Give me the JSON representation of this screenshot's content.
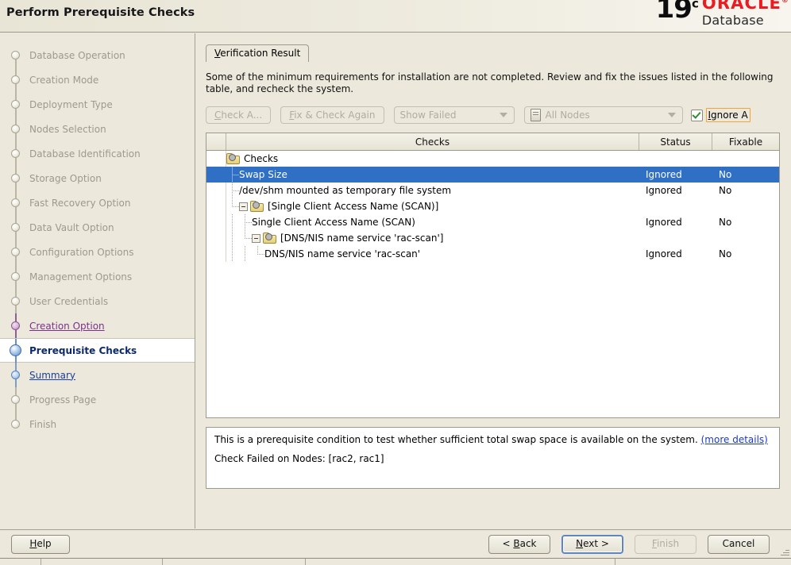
{
  "header": {
    "title": "Perform Prerequisite Checks",
    "brand": {
      "version": "19",
      "version_sup": "c",
      "oracle": "ORACLE",
      "oracle_sup": "®",
      "product": "Database"
    }
  },
  "sidebar": {
    "items": [
      {
        "label": "Database Operation",
        "state": "done"
      },
      {
        "label": "Creation Mode",
        "state": "done"
      },
      {
        "label": "Deployment Type",
        "state": "done"
      },
      {
        "label": "Nodes Selection",
        "state": "done"
      },
      {
        "label": "Database Identification",
        "state": "done"
      },
      {
        "label": "Storage Option",
        "state": "done"
      },
      {
        "label": "Fast Recovery Option",
        "state": "done"
      },
      {
        "label": "Data Vault Option",
        "state": "done"
      },
      {
        "label": "Configuration Options",
        "state": "done"
      },
      {
        "label": "Management Options",
        "state": "done"
      },
      {
        "label": "User Credentials",
        "state": "done"
      },
      {
        "label": "Creation Option",
        "state": "visited"
      },
      {
        "label": "Prerequisite Checks",
        "state": "current"
      },
      {
        "label": "Summary",
        "state": "next"
      },
      {
        "label": "Progress Page",
        "state": "done"
      },
      {
        "label": "Finish",
        "state": "done"
      }
    ]
  },
  "main": {
    "tab": {
      "mnemonic": "V",
      "rest": "erification Result"
    },
    "intro": "Some of the minimum requirements for installation are not completed. Review and fix the issues listed in the following table, and recheck the system.",
    "toolbar": {
      "check_again": {
        "mnemonic": "C",
        "rest": "heck A..."
      },
      "fix_and_check": {
        "mnemonic": "F",
        "rest": "ix & Check Again"
      },
      "filter_value": "Show Failed",
      "nodes_value": "All Nodes",
      "ignore_all": {
        "mnemonic": "I",
        "rest": "gnore A"
      },
      "ignore_all_checked": true
    },
    "table": {
      "columns": [
        "",
        "Checks",
        "Status",
        "Fixable"
      ],
      "rows": [
        {
          "label": "Checks",
          "status": "",
          "fixable": "",
          "depth": 0,
          "type": "folder",
          "expanded": true,
          "selected": false
        },
        {
          "label": "Swap Size",
          "status": "Ignored",
          "fixable": "No",
          "depth": 1,
          "type": "leaf",
          "selected": true
        },
        {
          "label": "/dev/shm mounted as temporary file system",
          "status": "Ignored",
          "fixable": "No",
          "depth": 1,
          "type": "leaf",
          "selected": false
        },
        {
          "label": "[Single Client Access Name (SCAN)]",
          "status": "",
          "fixable": "",
          "depth": 1,
          "type": "folder",
          "expanded": true,
          "selected": false
        },
        {
          "label": "Single Client Access Name (SCAN)",
          "status": "Ignored",
          "fixable": "No",
          "depth": 2,
          "type": "leaf",
          "selected": false
        },
        {
          "label": "[DNS/NIS name service 'rac-scan']",
          "status": "",
          "fixable": "",
          "depth": 2,
          "type": "folder",
          "expanded": true,
          "selected": false
        },
        {
          "label": "DNS/NIS name service 'rac-scan'",
          "status": "Ignored",
          "fixable": "No",
          "depth": 3,
          "type": "leaf",
          "selected": false
        }
      ]
    },
    "details": {
      "text_before_link": "This is a prerequisite condition to test whether sufficient total swap space is available on the system. ",
      "link": "(more details)",
      "failed_nodes": "Check Failed on Nodes: [rac2, rac1]"
    }
  },
  "footer": {
    "help": {
      "mnemonic": "H",
      "rest": "elp"
    },
    "back": {
      "prefix": "< ",
      "mnemonic": "B",
      "rest": "ack"
    },
    "next": {
      "prefix": "",
      "mnemonic": "N",
      "rest": "ext >"
    },
    "finish": {
      "mnemonic": "F",
      "rest": "inish",
      "disabled": true
    },
    "cancel": {
      "label": "Cancel"
    }
  },
  "colors": {
    "accent_selection": "#2f6fc4",
    "oracle_red": "#ea1b22",
    "background": "#ece9dc",
    "current_nav": "#0c2a6b",
    "visited_nav": "#7b2f8c",
    "link": "#1b39c8",
    "focus_orange": "#f0a23c",
    "check_green": "#2f8f2f"
  }
}
